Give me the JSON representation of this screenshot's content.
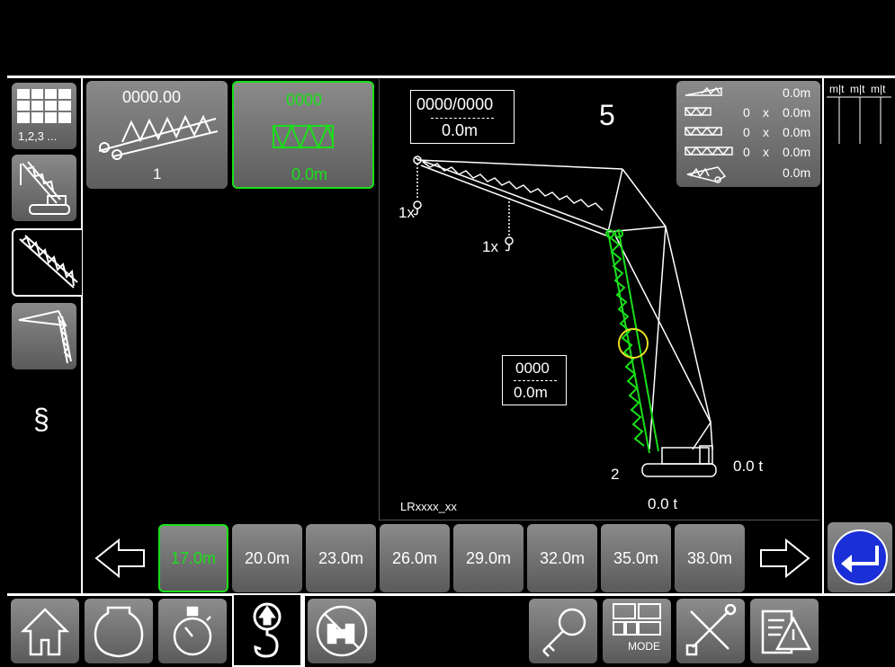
{
  "tabs": {
    "grid_label": "1,2,3 ...",
    "paragraph_label": "§"
  },
  "top_panels": {
    "panel1": {
      "value": "0000.00",
      "index": "1"
    },
    "panel2": {
      "value": "0000",
      "length": "0.0m"
    }
  },
  "diagram": {
    "top_counter": "0000/0000",
    "top_length": "0.0m",
    "state_number": "5",
    "hook1": "1x",
    "hook2": "1x",
    "mid_counter": "0000",
    "mid_length": "0.0m",
    "crawler_number": "2",
    "right_load": "0.0  t",
    "bottom_load": "0.0  t",
    "model": "LRxxxx_xx"
  },
  "boom_config": {
    "rows": [
      {
        "count": "",
        "x": "",
        "value": "0.0m"
      },
      {
        "count": "0",
        "x": "x",
        "value": "0.0m"
      },
      {
        "count": "0",
        "x": "x",
        "value": "0.0m"
      },
      {
        "count": "0",
        "x": "x",
        "value": "0.0m"
      },
      {
        "count": "",
        "x": "",
        "value": "0.0m"
      }
    ]
  },
  "right_table": {
    "headers": [
      "m|t",
      "m|t",
      "m|t"
    ]
  },
  "lengths": {
    "selected": "17.0m",
    "items": [
      "17.0m",
      "20.0m",
      "23.0m",
      "26.0m",
      "29.0m",
      "32.0m",
      "35.0m",
      "38.0m"
    ]
  },
  "toolbar": {
    "mode_label": "MODE"
  },
  "colors": {
    "accent_green": "#19e019",
    "enter_blue": "#1b2fd8",
    "selection_ring": "#e8e020"
  }
}
